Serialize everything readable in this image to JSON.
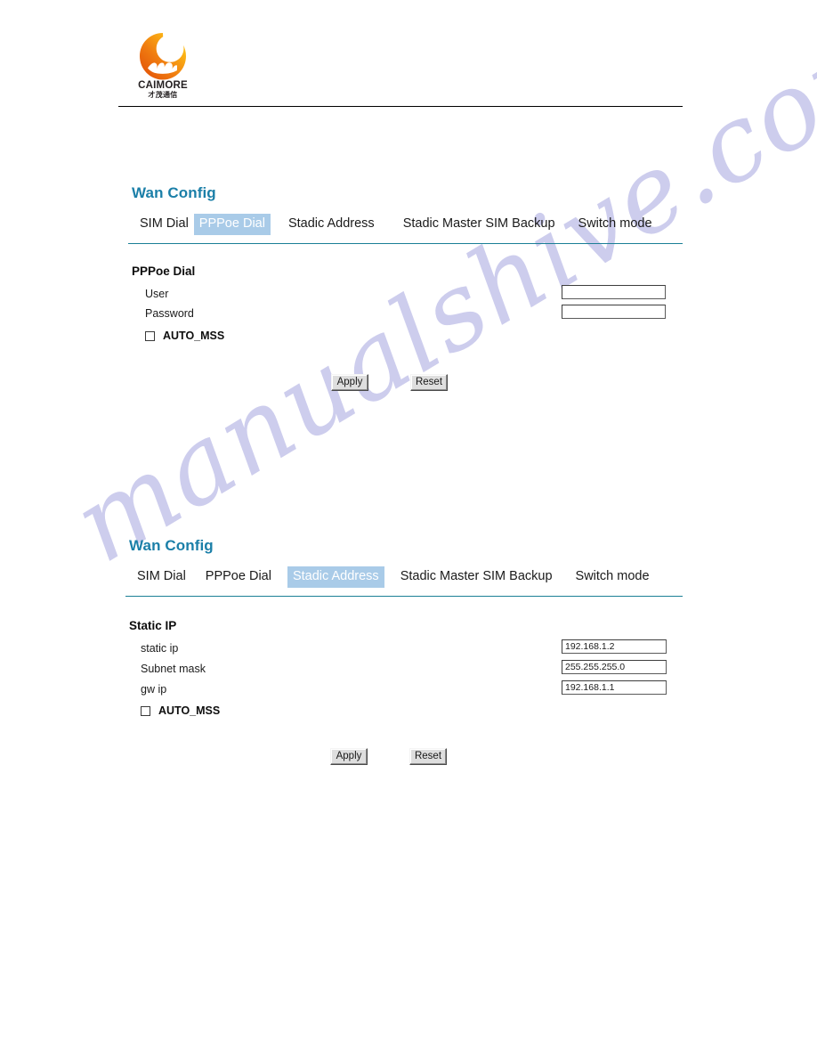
{
  "brand": {
    "logo_icon": "crescent-moon-logo",
    "name": "CAIMORE",
    "name_cn": "才茂通信"
  },
  "watermark": {
    "text": "manualshive.com"
  },
  "sections": [
    {
      "id": "pppoe",
      "heading": "Wan Config",
      "tabs": [
        {
          "label": "SIM Dial",
          "active": false
        },
        {
          "label": "PPPoe Dial",
          "active": true
        },
        {
          "label": "Stadic Address",
          "active": false
        },
        {
          "label": "Stadic Master SIM Backup",
          "active": false
        },
        {
          "label": "Switch mode",
          "active": false
        }
      ],
      "form_title": "PPPoe Dial",
      "fields": [
        {
          "label": "User",
          "value": ""
        },
        {
          "label": "Password",
          "value": ""
        }
      ],
      "checkbox": {
        "label": "AUTO_MSS",
        "checked": false
      },
      "buttons": {
        "apply": "Apply",
        "reset": "Reset"
      }
    },
    {
      "id": "static",
      "heading": "Wan Config",
      "tabs": [
        {
          "label": "SIM Dial",
          "active": false
        },
        {
          "label": "PPPoe Dial",
          "active": false
        },
        {
          "label": "Stadic Address",
          "active": true
        },
        {
          "label": "Stadic Master SIM Backup",
          "active": false
        },
        {
          "label": "Switch mode",
          "active": false
        }
      ],
      "form_title": "Static IP",
      "fields": [
        {
          "label": "static ip",
          "value": "192.168.1.2"
        },
        {
          "label": "Subnet mask",
          "value": "255.255.255.0"
        },
        {
          "label": "gw ip",
          "value": "192.168.1.1"
        }
      ],
      "checkbox": {
        "label": "AUTO_MSS",
        "checked": false
      },
      "buttons": {
        "apply": "Apply",
        "reset": "Reset"
      }
    }
  ],
  "colors": {
    "heading": "#1b7fa8",
    "tab_active_bg": "#a9cbe8",
    "tab_rule": "#1b7f96",
    "watermark": "#c9c9ec",
    "logo_orange": "#e8620c",
    "logo_yellow": "#fbbf24"
  }
}
